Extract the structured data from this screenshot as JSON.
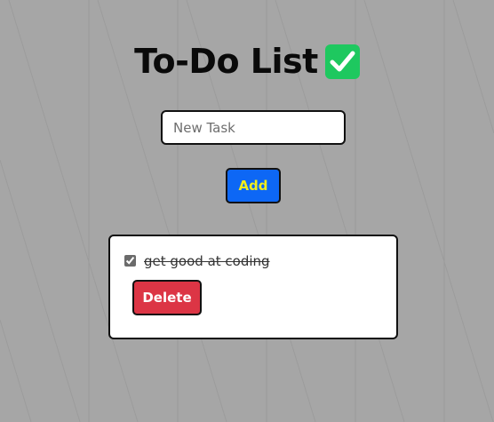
{
  "app": {
    "title": "To-Do List",
    "title_icon": "check-mark-button-icon"
  },
  "new_task": {
    "placeholder": "New Task",
    "value": ""
  },
  "add_button": {
    "label": "Add"
  },
  "tasks": [
    {
      "text": "get good at coding",
      "completed": true,
      "delete_label": "Delete"
    }
  ],
  "colors": {
    "background": "#a6a6a6",
    "add_button_bg": "#0d67f5",
    "add_button_text": "#f2ee1b",
    "delete_button_bg": "#dc3545",
    "title_icon_bg": "#1ec85f"
  }
}
